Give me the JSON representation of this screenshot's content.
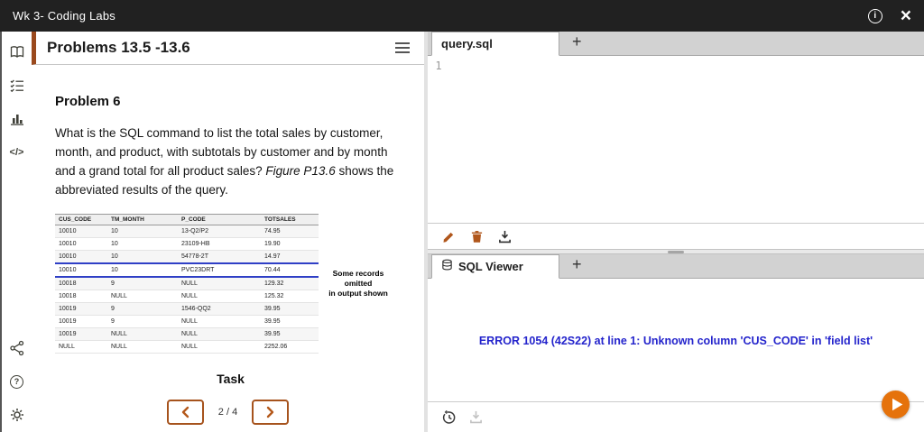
{
  "topbar": {
    "title": "Wk 3- Coding Labs"
  },
  "icons": {
    "info_glyph": "i",
    "close_glyph": "×",
    "help_glyph": "?",
    "code_glyph": "</>"
  },
  "left_panel": {
    "header": "Problems 13.5 -13.6",
    "problem": {
      "title": "Problem 6",
      "text_before": "What is the SQL command to list the total sales by customer, month, and product, with subtotals by customer and by month and a grand total for all product sales? ",
      "text_italic": "Figure P13.6",
      "text_after": " shows the abbreviated results of the query."
    },
    "figure": {
      "columns": [
        "CUS_CODE",
        "TM_MONTH",
        "P_CODE",
        "TOTSALES"
      ],
      "rows": [
        [
          "10010",
          "10",
          "13-Q2/P2",
          "74.95"
        ],
        [
          "10010",
          "10",
          "23109-HB",
          "19.90"
        ],
        [
          "10010",
          "10",
          "54778-2T",
          "14.97"
        ],
        [
          "10010",
          "10",
          "PVC23DRT",
          "70.44"
        ],
        [
          "10018",
          "9",
          "NULL",
          "129.32"
        ],
        [
          "10018",
          "NULL",
          "NULL",
          "125.32"
        ],
        [
          "10019",
          "9",
          "1546-QQ2",
          "39.95"
        ],
        [
          "10019",
          "9",
          "NULL",
          "39.95"
        ],
        [
          "10019",
          "NULL",
          "NULL",
          "39.95"
        ],
        [
          "NULL",
          "NULL",
          "NULL",
          "2252.06"
        ]
      ],
      "highlighted_row": 3,
      "annotation_line1": "Some records omitted",
      "annotation_line2": "in output shown"
    },
    "task_heading": "Task",
    "pager": {
      "label": "2 / 4"
    }
  },
  "editor": {
    "tab_label": "query.sql",
    "new_tab_label": "+",
    "line_number": "1"
  },
  "viewer": {
    "tab_label": "SQL Viewer",
    "new_tab_label": "+",
    "error_text": "ERROR 1054 (42S22) at line 1: Unknown column 'CUS_CODE' in 'field list'"
  },
  "colors": {
    "accent_orange": "#a6531d",
    "play_orange": "#e5720b",
    "error_blue": "#2424cc",
    "highlight_blue": "#2f3fc6",
    "topbar_bg": "#212121"
  }
}
